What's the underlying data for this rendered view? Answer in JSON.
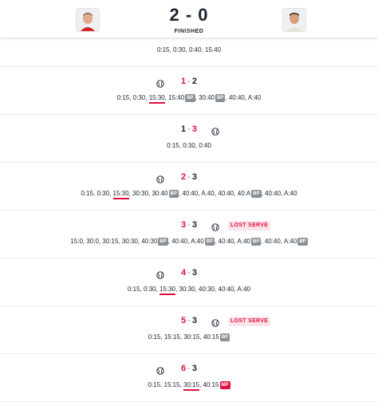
{
  "header": {
    "score": "2 - 0",
    "status": "FINISHED",
    "home_avatar": "player-avatar-home",
    "away_avatar": "player-avatar-away"
  },
  "colors": {
    "accent": "#e0103c",
    "badge_grey": "#8a8f98",
    "badge_mp": "#e0103c",
    "lost_bg": "#fde4ea"
  },
  "games": [
    {
      "score_left": "",
      "score_right": "",
      "server": "",
      "points": [
        {
          "t": "0:15"
        },
        {
          "t": "0:30"
        },
        {
          "t": "0:40"
        },
        {
          "t": "15:40"
        }
      ]
    },
    {
      "score_left": "1",
      "score_right": "2",
      "lead": "left",
      "server": "left",
      "points": [
        {
          "t": "0:15"
        },
        {
          "t": "0:30"
        },
        {
          "t": "15:30",
          "ul": true
        },
        {
          "t": "15:40",
          "badge": "BP"
        },
        {
          "t": "30:40",
          "badge": "BP"
        },
        {
          "t": "40:40"
        },
        {
          "t": "A:40"
        }
      ]
    },
    {
      "score_left": "1",
      "score_right": "3",
      "lead": "right",
      "server": "right",
      "points": [
        {
          "t": "0:15"
        },
        {
          "t": "0:30"
        },
        {
          "t": "0:40"
        }
      ]
    },
    {
      "score_left": "2",
      "score_right": "3",
      "lead": "left",
      "server": "left",
      "points": [
        {
          "t": "0:15"
        },
        {
          "t": "0:30"
        },
        {
          "t": "15:30",
          "ul": true
        },
        {
          "t": "30:30"
        },
        {
          "t": "30:40",
          "badge": "BP"
        },
        {
          "t": "40:40"
        },
        {
          "t": "A:40"
        },
        {
          "t": "40:40"
        },
        {
          "t": "40:A",
          "badge": "BP"
        },
        {
          "t": "40:40"
        },
        {
          "t": "A:40"
        }
      ]
    },
    {
      "score_left": "3",
      "score_right": "3",
      "lead": "left",
      "server": "right",
      "lost": "LOST SERVE",
      "points": [
        {
          "t": "15:0"
        },
        {
          "t": "30:0"
        },
        {
          "t": "30:15"
        },
        {
          "t": "30:30"
        },
        {
          "t": "40:30",
          "badge": "BP"
        },
        {
          "t": "40:40"
        },
        {
          "t": "A:40",
          "badge": "BP"
        },
        {
          "t": "40:40"
        },
        {
          "t": "A:40",
          "badge": "BP"
        },
        {
          "t": "40:40"
        },
        {
          "t": "A:40",
          "badge": "BP"
        }
      ]
    },
    {
      "score_left": "4",
      "score_right": "3",
      "lead": "left",
      "server": "left",
      "points": [
        {
          "t": "0:15"
        },
        {
          "t": "0:30"
        },
        {
          "t": "15:30",
          "ul": true
        },
        {
          "t": "30:30"
        },
        {
          "t": "40:30"
        },
        {
          "t": "40:40"
        },
        {
          "t": "A:40"
        }
      ]
    },
    {
      "score_left": "5",
      "score_right": "3",
      "lead": "left",
      "server": "right",
      "lost": "LOST SERVE",
      "points": [
        {
          "t": "0:15"
        },
        {
          "t": "15:15"
        },
        {
          "t": "30:15"
        },
        {
          "t": "40:15",
          "badge": "BP"
        }
      ]
    },
    {
      "score_left": "6",
      "score_right": "3",
      "lead": "left",
      "server": "left",
      "points": [
        {
          "t": "0:15"
        },
        {
          "t": "15:15"
        },
        {
          "t": "30:15",
          "ul": true
        },
        {
          "t": "40:15",
          "badge": "MP",
          "badge_type": "mp"
        }
      ]
    }
  ]
}
